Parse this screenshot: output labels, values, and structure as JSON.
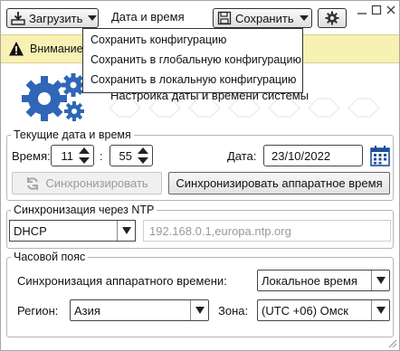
{
  "window": {
    "title": "Дата и время",
    "load_label": "Загрузить",
    "save_label": "Сохранить"
  },
  "warning": {
    "text": "Внимание"
  },
  "save_menu": {
    "items": [
      "Сохранить конфигурацию",
      "Сохранить в глобальную конфигурацию",
      "Сохранить в локальную конфигурацию"
    ]
  },
  "header": {
    "text": "Настройка даты и времени системы"
  },
  "current": {
    "legend": "Текущие дата и время",
    "time_label": "Время:",
    "hours": "11",
    "separator": ":",
    "minutes": "55",
    "date_label": "Дата:",
    "date": "23/10/2022",
    "sync_label": "Синхронизировать",
    "sync_hw_label": "Синхронизировать аппаратное время"
  },
  "ntp": {
    "legend": "Синхронизация через NTP",
    "mode": "DHCP",
    "servers_placeholder": "192.168.0.1,europa.ntp.org"
  },
  "tz": {
    "legend": "Часовой пояс",
    "hw_sync_label": "Синхронизация аппаратного времени:",
    "hw_sync_value": "Локальное время",
    "region_label": "Регион:",
    "region_value": "Азия",
    "zone_label": "Зона:",
    "zone_value": "(UTC +06) Омск"
  },
  "colors": {
    "warning_bg": "#f7f2b3",
    "gear_blue": "#2f66b8",
    "calendar_blue": "#1c4f9c"
  }
}
